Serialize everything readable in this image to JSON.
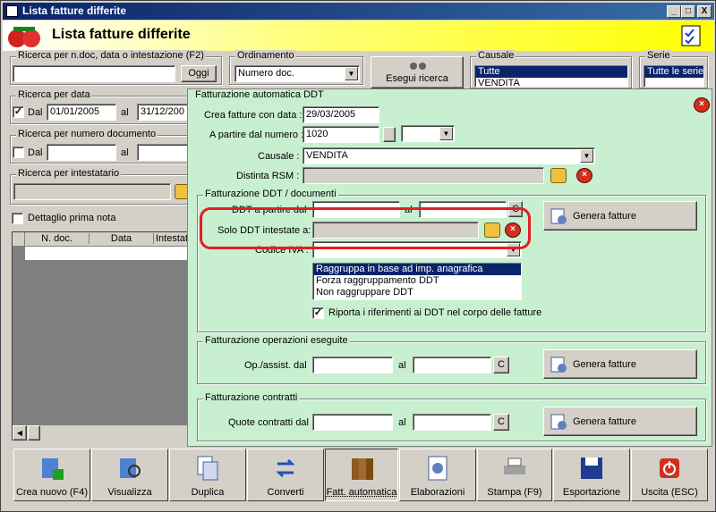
{
  "window": {
    "title": "Lista fatture differite",
    "min": "_",
    "max": "□",
    "close": "X"
  },
  "header": {
    "title": "Lista fatture differite"
  },
  "search_text": {
    "legend": "Ricerca per n.doc, data o intestazione (F2)",
    "value": "",
    "button": "Oggi"
  },
  "ordinamento": {
    "legend": "Ordinamento",
    "value": "Numero doc."
  },
  "esegui": {
    "label": "Esegui ricerca"
  },
  "causale_panel": {
    "legend": "Causale",
    "items": [
      "Tutte",
      "VENDITA"
    ]
  },
  "serie_panel": {
    "legend": "Serie",
    "items": [
      "Tutte le serie"
    ]
  },
  "search_date": {
    "legend": "Ricerca per data",
    "dal_label": "Dal",
    "dal_value": "01/01/2005",
    "al_label": "al",
    "al_value": "31/12/200"
  },
  "search_num": {
    "legend": "Ricerca per numero documento",
    "dal_label": "Dal",
    "al_label": "al"
  },
  "search_int": {
    "legend": "Ricerca per intestatario"
  },
  "dettaglio": {
    "label": "Dettaglio prima nota"
  },
  "grid": {
    "columns": [
      "N. doc.",
      "Data",
      "Intestatar"
    ]
  },
  "dialog": {
    "legend": "Fatturazione automatica DDT",
    "crea_label": "Crea fatture con data :",
    "crea_value": "29/03/2005",
    "partire_label": "A partire dal numero :",
    "partire_value": "1020",
    "causale_label": "Causale :",
    "causale_value": "VENDITA",
    "distinta_label": "Distinta RSM :",
    "ddt": {
      "legend": "Fatturazione DDT / documenti",
      "ddt_label": "DDT a partire dal",
      "al": "al",
      "c": "C",
      "solo_label": "Solo DDT intestate a:",
      "iva_label": "Codice IVA :",
      "genera": "Genera fatture",
      "options": [
        "Raggruppa in base ad imp. anagrafica",
        "Forza raggruppamento DDT",
        "Non raggruppare DDT"
      ],
      "riporta": "Riporta i riferimenti ai DDT nel corpo delle fatture"
    },
    "op": {
      "legend": "Fatturazione operazioni eseguite",
      "label": "Op./assist. dal",
      "al": "al",
      "c": "C",
      "genera": "Genera fatture"
    },
    "contratti": {
      "legend": "Fatturazione contratti",
      "label": "Quote contratti dal",
      "al": "al",
      "c": "C",
      "genera": "Genera fatture"
    }
  },
  "toolbar": [
    "Crea nuovo (F4)",
    "Visualizza",
    "Duplica",
    "Converti",
    "Fatt. automatica",
    "Elaborazioni",
    "Stampa (F9)",
    "Esportazione",
    "Uscita (ESC)"
  ]
}
